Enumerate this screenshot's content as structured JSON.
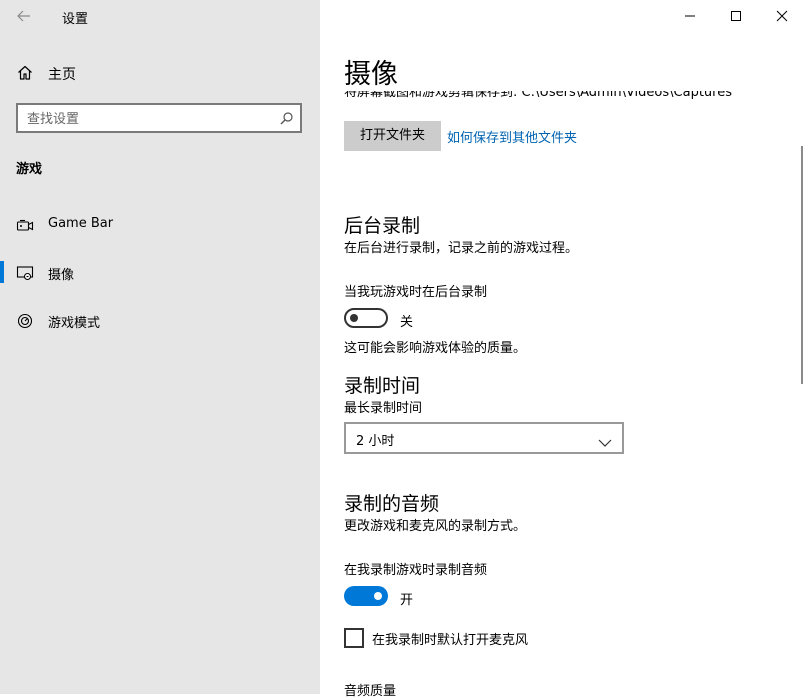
{
  "window": {
    "title": "设置",
    "colors": {
      "accent": "#0078d7",
      "link": "#0063b1",
      "sidebar_bg": "#e6e6e6"
    }
  },
  "sidebar": {
    "home_label": "主页",
    "search_placeholder": "查找设置",
    "section_label": "游戏",
    "items": [
      {
        "label": "Game Bar",
        "icon": "game-bar-icon",
        "selected": false
      },
      {
        "label": "摄像",
        "icon": "capture-icon",
        "selected": true
      },
      {
        "label": "游戏模式",
        "icon": "game-mode-icon",
        "selected": false
      }
    ]
  },
  "main": {
    "title": "摄像",
    "save_path_text": "将屏幕截图和游戏剪辑保存到: C:\\Users\\Admin\\Videos\\Captures",
    "open_folder_label": "打开文件夹",
    "other_folder_link": "如何保存到其他文件夹",
    "background": {
      "heading": "后台录制",
      "description": "在后台进行录制，记录之前的游戏过程。",
      "toggle_label": "当我玩游戏时在后台录制",
      "toggle_state": "关",
      "note": "这可能会影响游戏体验的质量。"
    },
    "record_time": {
      "heading": "录制时间",
      "label": "最长录制时间",
      "selected": "2 小时"
    },
    "audio": {
      "heading": "录制的音频",
      "description": "更改游戏和麦克风的录制方式。",
      "toggle_label": "在我录制游戏时录制音频",
      "toggle_state": "开",
      "checkbox_label": "在我录制时默认打开麦克风",
      "quality_label": "音频质量"
    }
  }
}
